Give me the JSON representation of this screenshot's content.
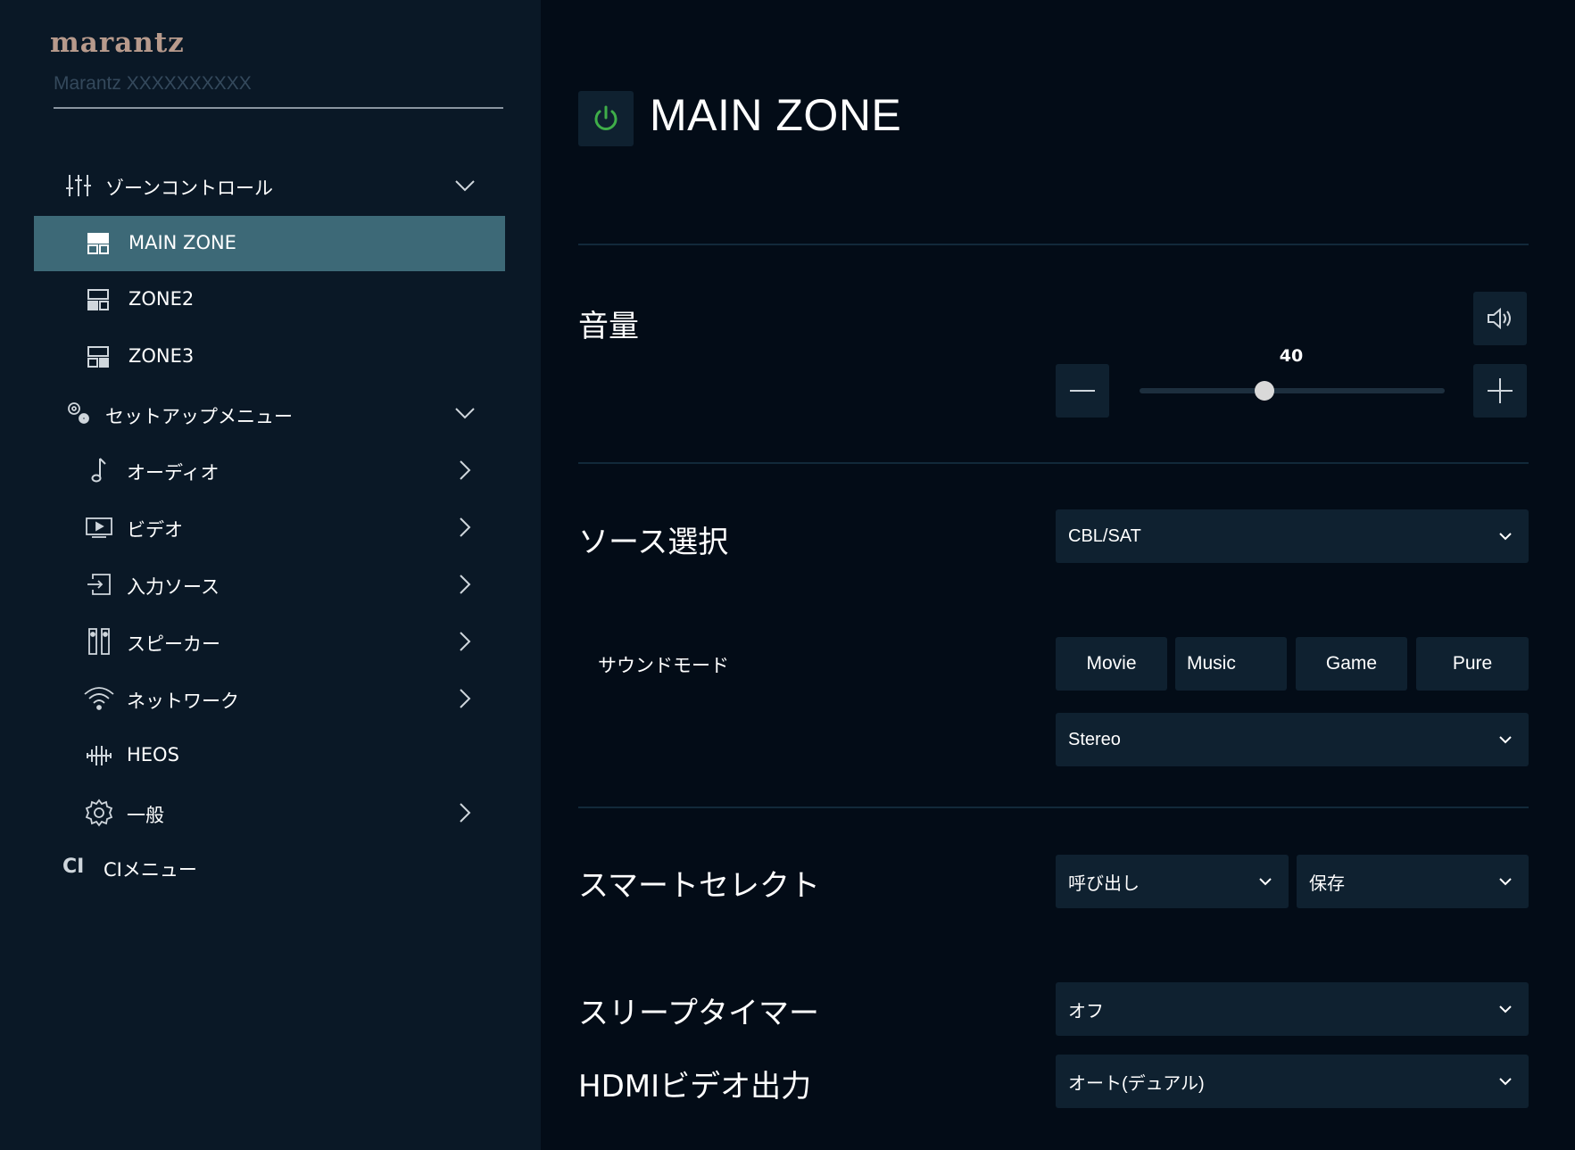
{
  "brand": "marantz",
  "device_name": "Marantz XXXXXXXXXX",
  "sidebar": {
    "zone_control": {
      "label": "ゾーンコントロール"
    },
    "zones": [
      {
        "label": "MAIN ZONE",
        "active": true
      },
      {
        "label": "ZONE2",
        "active": false
      },
      {
        "label": "ZONE3",
        "active": false
      }
    ],
    "setup_menu": {
      "label": "セットアップメニュー"
    },
    "setup_items": [
      {
        "label": "オーディオ",
        "icon": "music-note-icon",
        "has_submenu": true
      },
      {
        "label": "ビデオ",
        "icon": "video-icon",
        "has_submenu": true
      },
      {
        "label": "入力ソース",
        "icon": "input-source-icon",
        "has_submenu": true
      },
      {
        "label": "スピーカー",
        "icon": "speaker-icon",
        "has_submenu": true
      },
      {
        "label": "ネットワーク",
        "icon": "wifi-icon",
        "has_submenu": true
      },
      {
        "label": "HEOS",
        "icon": "heos-icon",
        "has_submenu": false
      },
      {
        "label": "一般",
        "icon": "gear-icon",
        "has_submenu": true
      }
    ],
    "ci_menu": {
      "badge": "CI",
      "label": "CIメニュー"
    }
  },
  "main": {
    "zone_title": "MAIN ZONE",
    "volume": {
      "label": "音量",
      "value": 40,
      "min": 0,
      "max": 98
    },
    "source": {
      "label": "ソース選択",
      "selected": "CBL/SAT"
    },
    "sound_mode": {
      "label": "サウンドモード",
      "buttons": [
        "Movie",
        "Music",
        "Game",
        "Pure"
      ],
      "selected": "Stereo"
    },
    "smart_select": {
      "label": "スマートセレクト",
      "recall": "呼び出し",
      "save": "保存"
    },
    "sleep_timer": {
      "label": "スリープタイマー",
      "selected": "オフ"
    },
    "hdmi_output": {
      "label": "HDMIビデオ出力",
      "selected": "オート(デュアル)"
    }
  },
  "colors": {
    "background": "#030c17",
    "sidebar": "#0a1826",
    "active_item": "#3d6977",
    "control_bg": "#0f2130",
    "power_green": "#3fae49",
    "brand": "#b79a8c"
  }
}
